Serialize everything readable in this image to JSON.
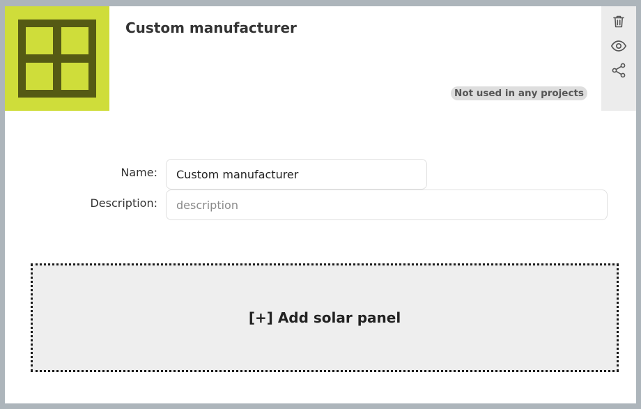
{
  "manufacturer": {
    "title": "Custom manufacturer",
    "usage_badge": "Not used in any projects"
  },
  "actions": [
    {
      "name": "delete",
      "icon": "trash-icon"
    },
    {
      "name": "view",
      "icon": "eye-icon"
    },
    {
      "name": "share",
      "icon": "share-icon"
    }
  ],
  "form": {
    "name_label": "Name:",
    "name_value": "Custom manufacturer",
    "description_label": "Description:",
    "description_value": "",
    "description_placeholder": "description"
  },
  "add_panel": {
    "label": "[+] Add solar panel"
  },
  "colors": {
    "thumb_bg": "#cfdd3a",
    "thumb_fg": "#555a14",
    "page_bg": "#adb5bb",
    "badge_bg": "#dedede"
  }
}
